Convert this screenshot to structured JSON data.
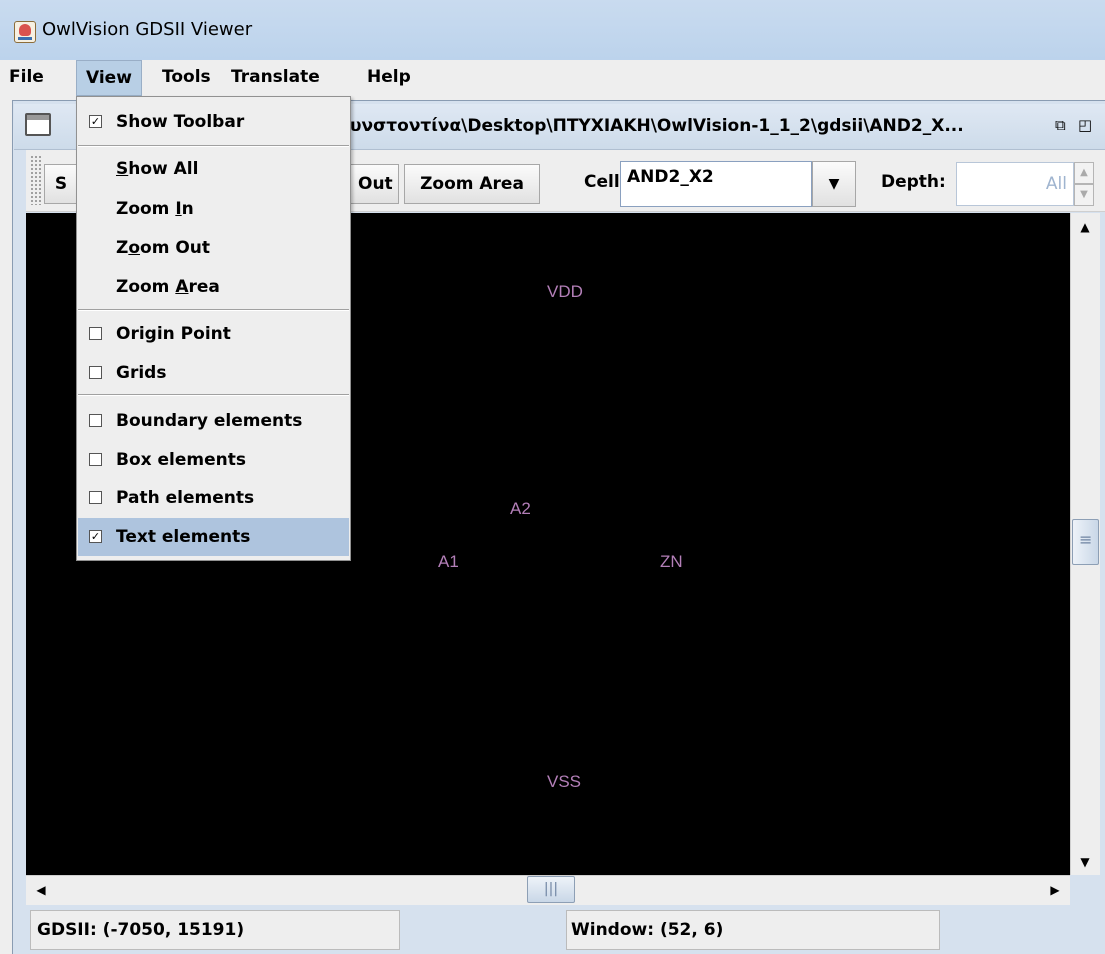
{
  "app": {
    "title": "OwlVision GDSII Viewer"
  },
  "menubar": [
    "File",
    "View",
    "Tools",
    "Translate",
    "Help"
  ],
  "frame": {
    "path": "υνστοντίνα\\Desktop\\ΠΤΥΧΙΑΚΗ\\OwlVision-1_1_2\\gdsii\\AND2_X..."
  },
  "toolbar": {
    "partial_button": "S",
    "zoom_out_partial": "Out",
    "zoom_area": "Zoom Area",
    "cell_label": "Cell:",
    "cell_value": "AND2_X2",
    "depth_label": "Depth:",
    "depth_value": "All"
  },
  "view_menu": {
    "show_toolbar": "Show Toolbar",
    "show_all": "Show All",
    "zoom_in": "Zoom In",
    "zoom_out": "Zoom Out",
    "zoom_area": "Zoom Area",
    "origin_point": "Origin Point",
    "grids": "Grids",
    "boundary_elements": "Boundary elements",
    "box_elements": "Box elements",
    "path_elements": "Path elements",
    "text_elements": "Text elements",
    "checked": {
      "show_toolbar": true,
      "origin_point": false,
      "grids": false,
      "boundary_elements": false,
      "box_elements": false,
      "path_elements": false,
      "text_elements": true
    }
  },
  "canvas": {
    "labels": {
      "vdd": "VDD",
      "a2": "A2",
      "a1": "A1",
      "zn": "ZN",
      "vss": "VSS"
    },
    "label_color": "#b37fb8"
  },
  "status": {
    "gdsii": "GDSII: (-7050, 15191)",
    "window": "Window: (52, 6)"
  }
}
